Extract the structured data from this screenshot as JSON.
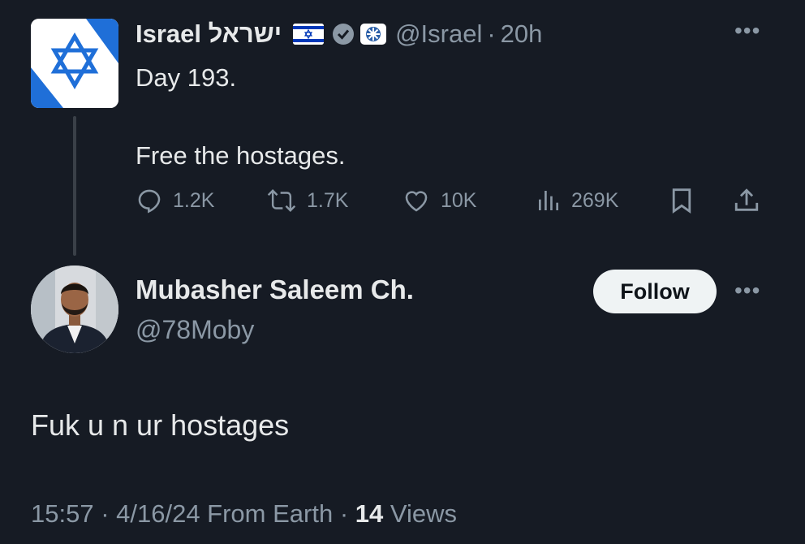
{
  "parent_tweet": {
    "display_name": "Israel ישראל",
    "handle": "@Israel",
    "time": "20h",
    "text": "Day 193.\n\nFree the hostages.",
    "actions": {
      "replies": "1.2K",
      "reposts": "1.7K",
      "likes": "10K",
      "views": "269K"
    }
  },
  "reply": {
    "display_name": "Mubasher Saleem Ch.",
    "handle": "@78Moby",
    "follow_label": "Follow",
    "text": "Fuk u n ur hostages",
    "timestamp": "15:57 · 4/16/24 From Earth",
    "views_count": "14",
    "views_label": "Views"
  },
  "colors": {
    "background": "#161b24",
    "text_primary": "#e7e9ea",
    "text_secondary": "#8b98a5",
    "israel_blue": "#0038b8"
  },
  "icons": [
    "star-of-david-avatar",
    "israel-flag-icon",
    "verified-badge-icon",
    "organization-badge-icon",
    "more-icon",
    "reply-icon",
    "repost-icon",
    "like-icon",
    "views-icon",
    "bookmark-icon",
    "share-icon"
  ]
}
